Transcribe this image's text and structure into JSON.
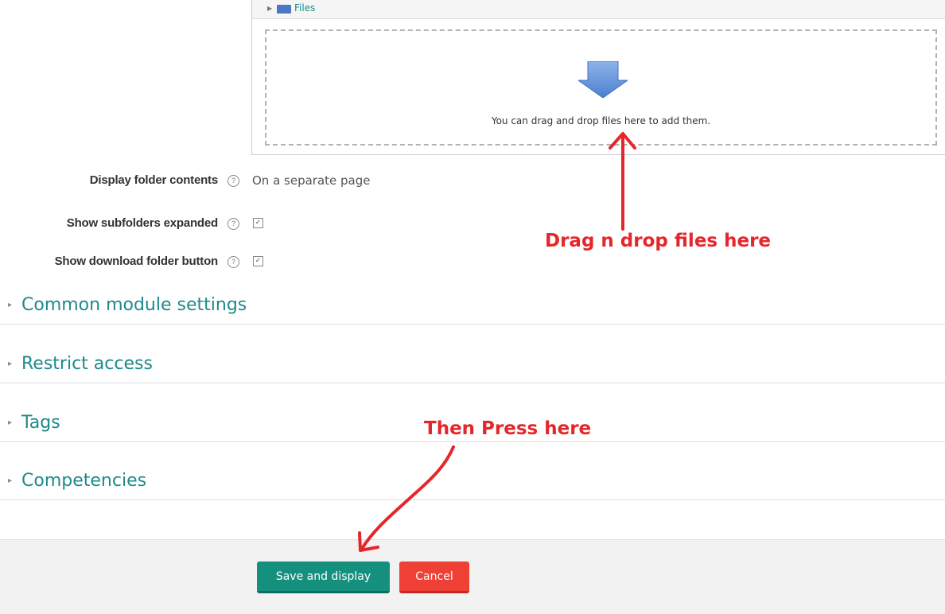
{
  "file_manager": {
    "path_label": "Files",
    "drop_text": "You can drag and drop files here to add them."
  },
  "settings": [
    {
      "label": "Display folder contents",
      "value": "On a separate page"
    },
    {
      "label": "Show subfolders expanded",
      "checked": true
    },
    {
      "label": "Show download folder button",
      "checked": true
    }
  ],
  "sections": [
    {
      "title": "Common module settings"
    },
    {
      "title": "Restrict access"
    },
    {
      "title": "Tags"
    },
    {
      "title": "Competencies"
    }
  ],
  "buttons": {
    "save": "Save and display",
    "cancel": "Cancel"
  },
  "annotations": {
    "drag": "Drag n drop files here",
    "press": "Then Press here"
  },
  "icons": {
    "help": "question-mark",
    "check": "✓",
    "collapsed_section": "▸",
    "help_glyph": "?"
  },
  "colors": {
    "accent": "#1e8a8a",
    "primary_button": "#15907f",
    "danger_button": "#ef4036",
    "annotation": "#e5262a"
  }
}
